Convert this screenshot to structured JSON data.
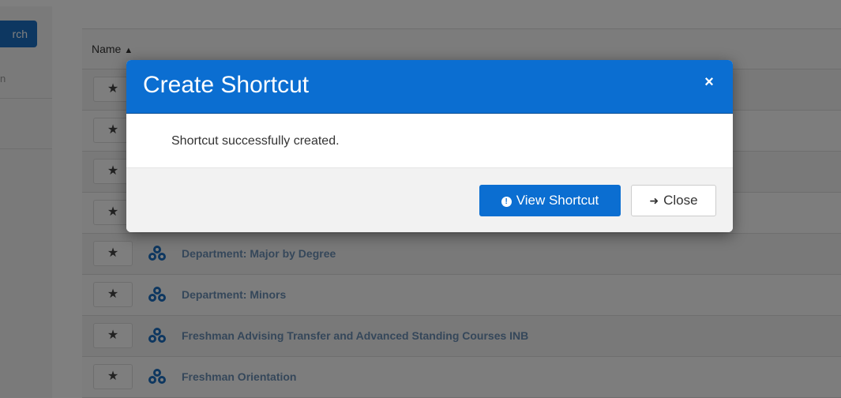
{
  "sidebar": {
    "search_label": "rch",
    "sub_label": "n"
  },
  "table": {
    "header": {
      "name_label": "Name",
      "sort_icon": "chevron-up-icon"
    },
    "star_glyph": "★",
    "rows": [
      {
        "label": ""
      },
      {
        "label": ""
      },
      {
        "label": ""
      },
      {
        "label": ""
      },
      {
        "label": "Department: Major by Degree"
      },
      {
        "label": "Department: Minors"
      },
      {
        "label": "Freshman Advising Transfer and Advanced Standing Courses INB"
      },
      {
        "label": "Freshman Orientation"
      }
    ]
  },
  "modal": {
    "title": "Create Shortcut",
    "close_glyph": "×",
    "message": "Shortcut successfully created.",
    "primary_button": {
      "label": "View Shortcut",
      "icon": "info-circle-icon"
    },
    "secondary_button": {
      "label": "Close",
      "icon": "arrow-right-icon",
      "glyph": "➜"
    }
  },
  "colors": {
    "accent": "#0b6ed1",
    "overlay": "rgba(0,0,0,0.5)"
  }
}
